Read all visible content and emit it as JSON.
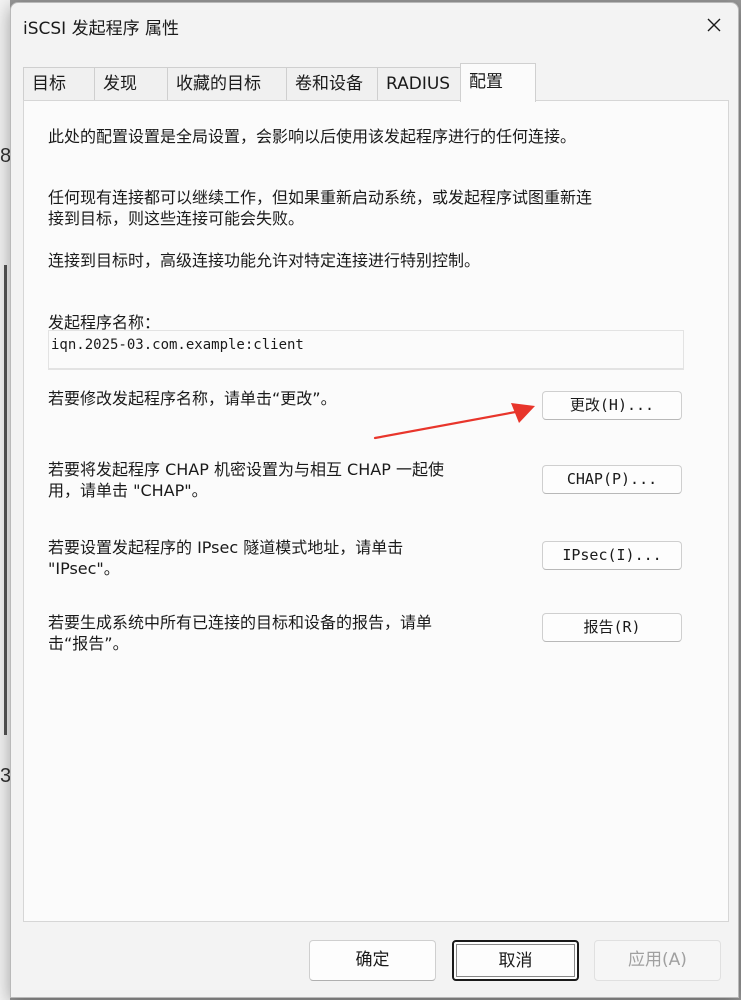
{
  "background": {
    "chars": [
      "8",
      "3"
    ]
  },
  "window": {
    "title": "iSCSI 发起程序 属性"
  },
  "tabs": [
    {
      "label": "目标"
    },
    {
      "label": "发现"
    },
    {
      "label": "收藏的目标"
    },
    {
      "label": "卷和设备"
    },
    {
      "label": "RADIUS"
    },
    {
      "label": "配置"
    }
  ],
  "config": {
    "intro": "此处的配置设置是全局设置，会影响以后使用该发起程序进行的任何连接。",
    "note_line1": "任何现有连接都可以继续工作，但如果重新启动系统，或发起程序试图重新连",
    "note_line2": "接到目标，则这些连接可能会失败。",
    "advanced": "连接到目标时，高级连接功能允许对特定连接进行特别控制。",
    "name_label": "发起程序名称：",
    "name_value": "iqn.2025-03.com.example:client",
    "change_text": "若要修改发起程序名称，请单击“更改”。",
    "change_button": "更改(H)...",
    "chap_line1": "若要将发起程序 CHAP 机密设置为与相互 CHAP 一起使",
    "chap_line2": "用，请单击 \"CHAP\"。",
    "chap_button": "CHAP(P)...",
    "ipsec_line1": "若要设置发起程序的 IPsec 隧道模式地址，请单击",
    "ipsec_line2": "\"IPsec\"。",
    "ipsec_button": "IPsec(I)...",
    "report_line1": "若要生成系统中所有已连接的目标和设备的报告，请单",
    "report_line2": "击“报告”。",
    "report_button": "报告(R)"
  },
  "footer": {
    "ok": "确定",
    "cancel": "取消",
    "apply": "应用(A)"
  },
  "colors": {
    "arrow": "#e8352b"
  }
}
